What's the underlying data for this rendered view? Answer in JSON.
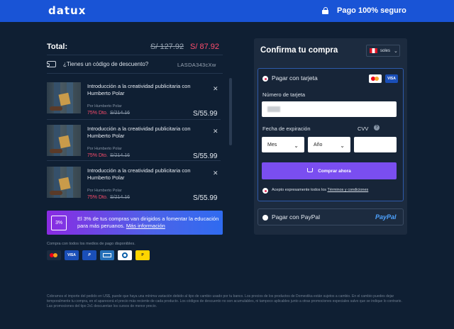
{
  "header": {
    "logo": "datux",
    "secure_label": "Pago 100% seguro"
  },
  "summary": {
    "total_label": "Total:",
    "old_total": "S/ 127.92",
    "new_total": "S/ 87.92"
  },
  "coupon": {
    "question": "¿Tienes un código de descuento?",
    "code": "LASDA343cXw"
  },
  "courses": [
    {
      "title": "Introducción a la creatividad publicitaria con Humberto Polar",
      "author": "Por Humberto Polar",
      "discount": "75% Dto.",
      "old_price": "S/214.16",
      "price": "S/55.99"
    },
    {
      "title": "Introducción a la creatividad publicitaria con Humberto Polar",
      "author": "Por Humberto Polar",
      "discount": "75% Dto.",
      "old_price": "S/214.16",
      "price": "S/55.99"
    },
    {
      "title": "Introducción a la creatividad publicitaria con Humberto Polar",
      "author": "Por Humberto Polar",
      "discount": "75% Dto.",
      "old_price": "S/214.16",
      "price": "S/55.99"
    }
  ],
  "close_glyph": "✕",
  "banner": {
    "badge": "3%",
    "text": "El 3% de tus compras van dirigidos a fomentar la educación para más peruanos.",
    "link": "Más información"
  },
  "payment_note": "Compra con todos los medios de pago disponibles.",
  "payment_logos": [
    "mastercard-icon",
    "visa-icon",
    "paypal-icon",
    "amex-icon",
    "diners-icon",
    "pagoefectivo-icon"
  ],
  "visa_text": "VISA",
  "paypal_short": "P",
  "footer": "Cobramos el importe del pedido en US$, puede que haya una mínima variación debido al tipo de cambio usado por tu banco. Los precios de los productos de Domestika están sujetos a cambio. En el cambio puedes dejar temporalmente tu compra, en el aparecerá el precio más reciente de cada producto. Los códigos de descuento no son acumulables, ni tampoco aplicables junto a otras promociones especiales salvo que se indique lo contrario. Las promociones del tipo 2x1 descuentan los cursos de menor precio.",
  "checkout": {
    "title": "Confirma tu compra",
    "currency": "soles",
    "card_option": "Pagar con tarjeta",
    "card_number_label": "Número de tarjeta",
    "expiry_label": "Fecha de expiración",
    "cvv_label": "CVV",
    "help_glyph": "?",
    "month_value": "Mes",
    "year_value": "Año",
    "buy_button": "Comprar ahora",
    "terms_prefix": "Acepto expresamente todos los",
    "terms_link": "Términos y condiciones",
    "paypal_option": "Pagar con PayPal",
    "paypal_logo": "PayPal"
  },
  "colors": {
    "accent": "#1954d6",
    "discount": "#ff4d6d",
    "buy": "#7a4ef0"
  }
}
